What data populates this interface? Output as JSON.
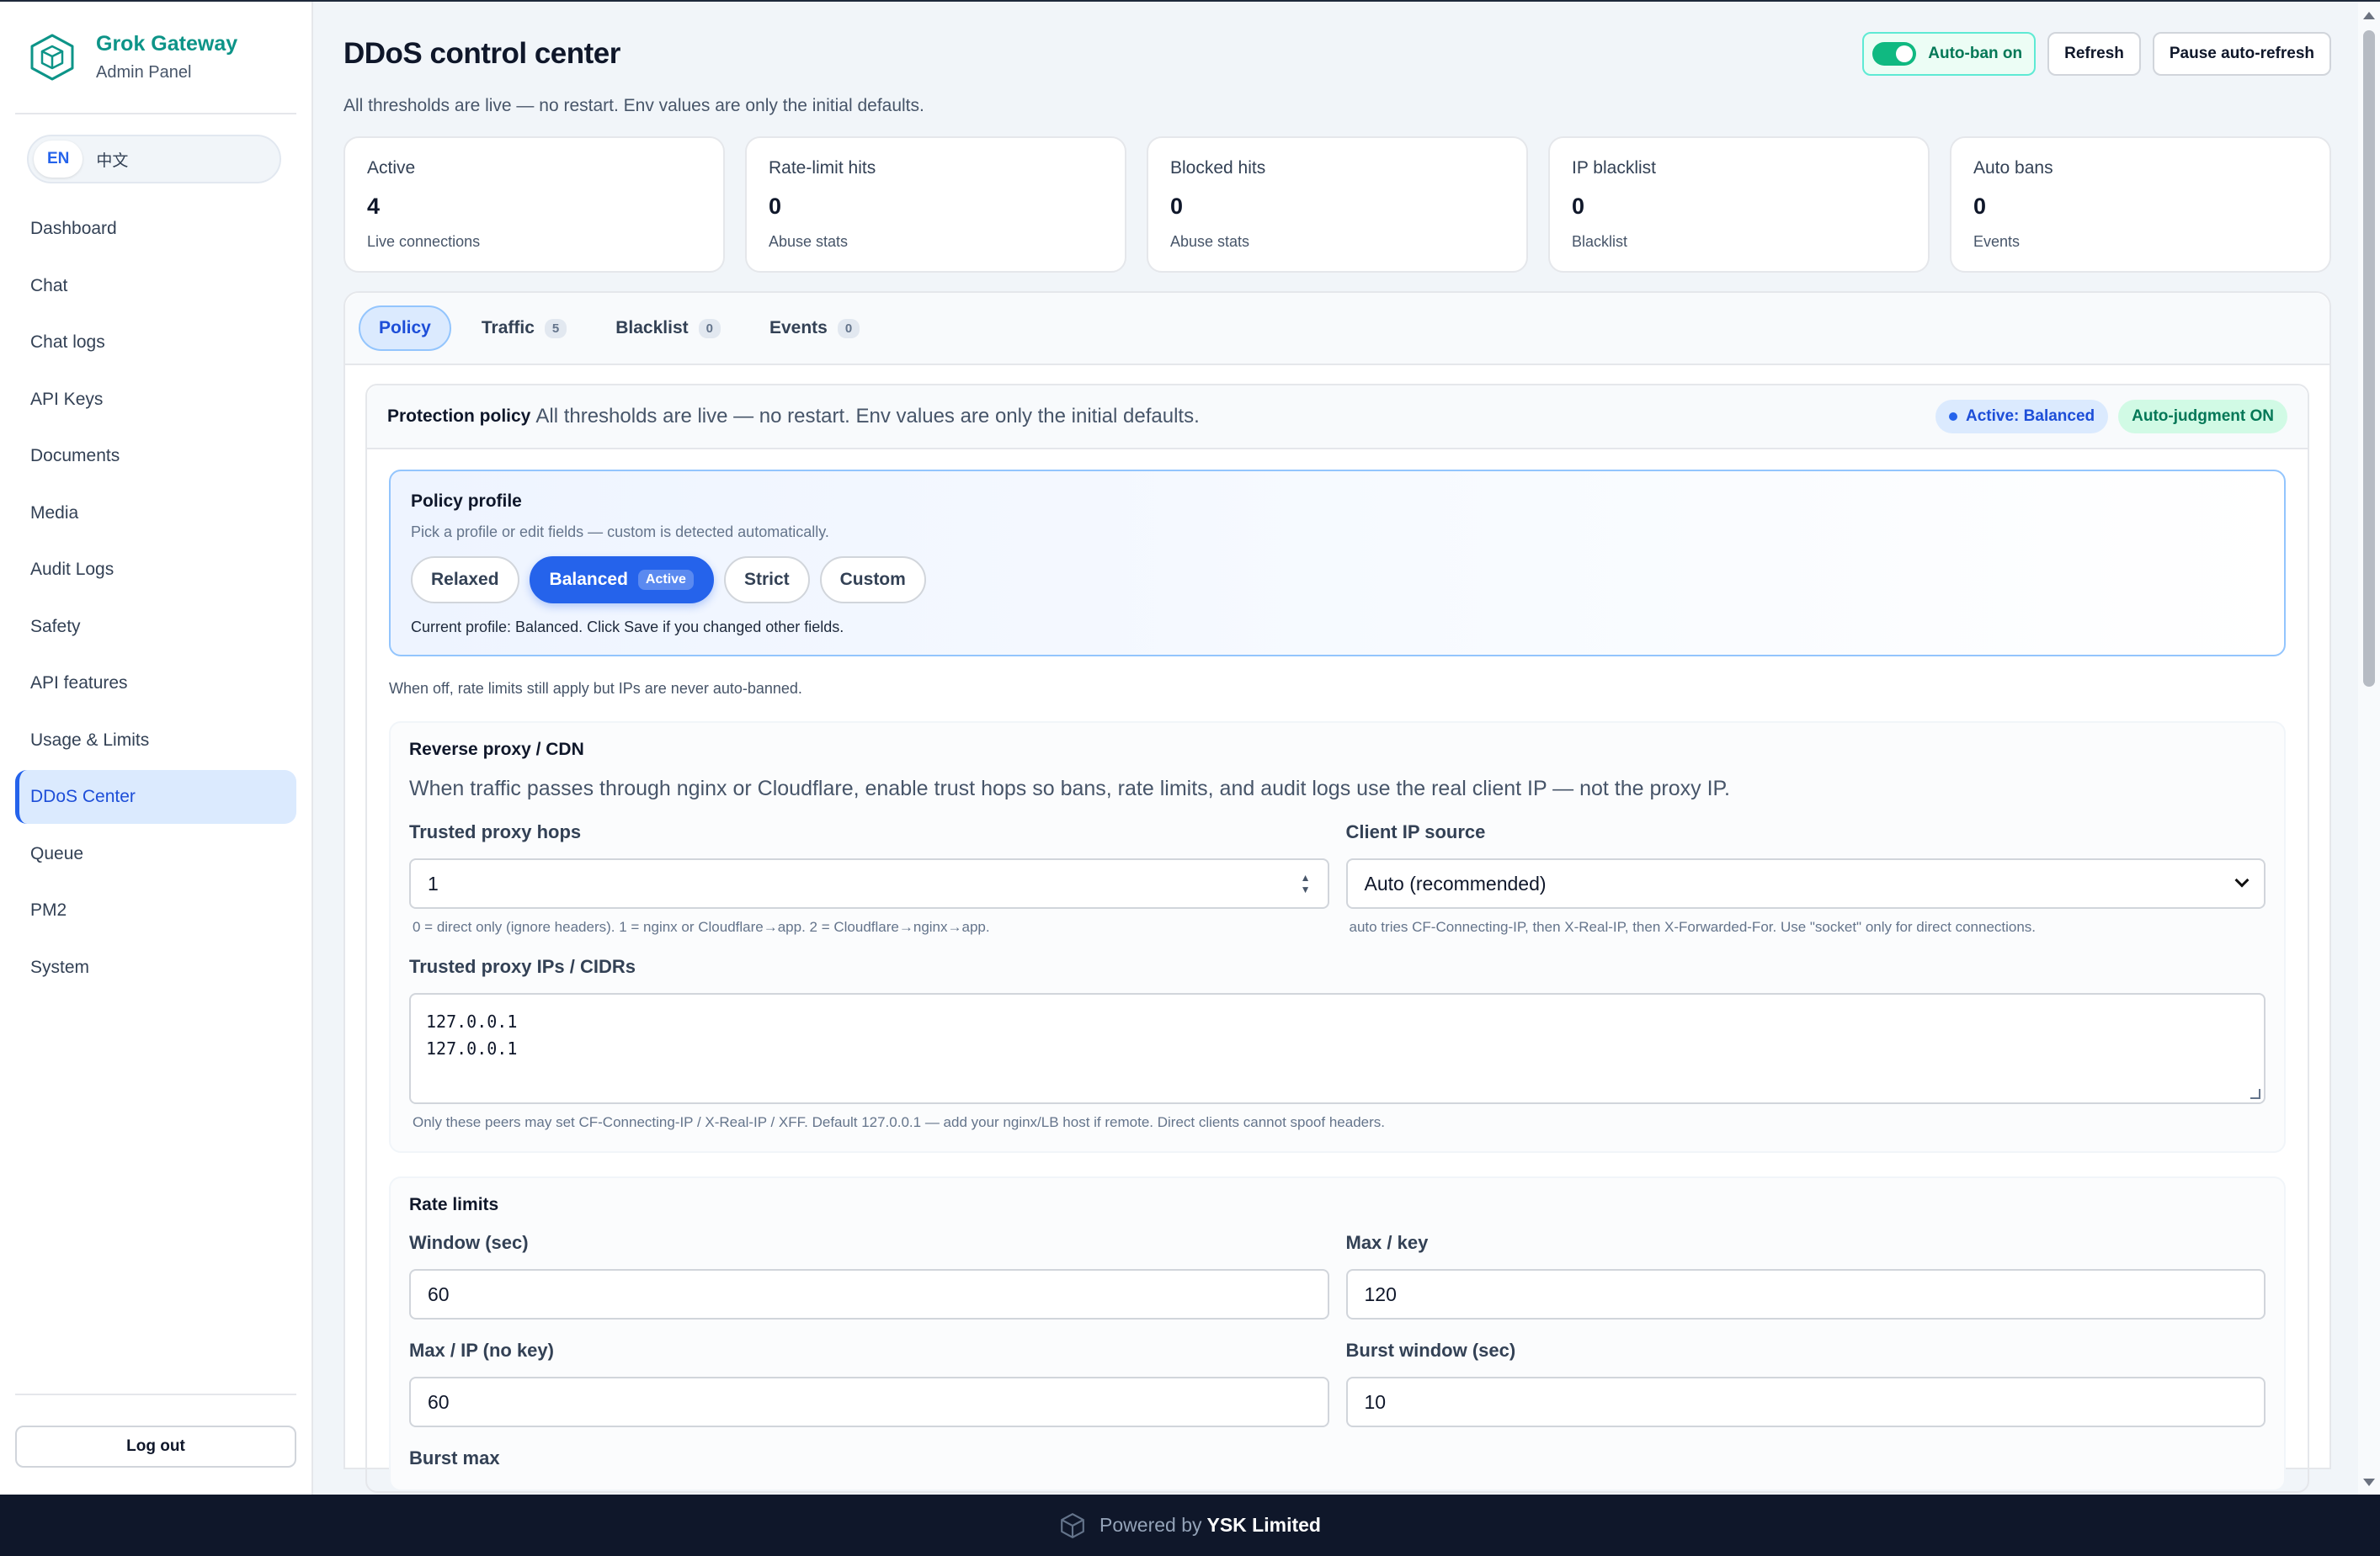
{
  "brand": {
    "name": "Grok Gateway",
    "subtitle": "Admin Panel"
  },
  "lang": {
    "en": "EN",
    "zh": "中文"
  },
  "nav": [
    "Dashboard",
    "Chat",
    "Chat logs",
    "API Keys",
    "Documents",
    "Media",
    "Audit Logs",
    "Safety",
    "API features",
    "Usage & Limits",
    "DDoS Center",
    "Queue",
    "PM2",
    "System"
  ],
  "nav_active": "DDoS Center",
  "logout": "Log out",
  "header": {
    "title": "DDoS control center",
    "subtitle": "All thresholds are live — no restart. Env values are only the initial defaults.",
    "autoban": "Auto-ban on",
    "refresh": "Refresh",
    "pause": "Pause auto-refresh"
  },
  "stats": [
    {
      "label": "Active",
      "value": "4",
      "note": "Live connections"
    },
    {
      "label": "Rate-limit hits",
      "value": "0",
      "note": "Abuse stats"
    },
    {
      "label": "Blocked hits",
      "value": "0",
      "note": "Abuse stats"
    },
    {
      "label": "IP blacklist",
      "value": "0",
      "note": "Blacklist"
    },
    {
      "label": "Auto bans",
      "value": "0",
      "note": "Events"
    }
  ],
  "tabs": [
    {
      "label": "Policy",
      "count": ""
    },
    {
      "label": "Traffic",
      "count": "5"
    },
    {
      "label": "Blacklist",
      "count": "0"
    },
    {
      "label": "Events",
      "count": "0"
    }
  ],
  "policy": {
    "title": "Protection policy",
    "subtitle": "All thresholds are live — no restart. Env values are only the initial defaults.",
    "badge_active": "Active: Balanced",
    "badge_auto": "Auto-judgment ON",
    "profile_title": "Policy profile",
    "profile_sub": "Pick a profile or edit fields — custom is detected automatically.",
    "profiles": [
      "Relaxed",
      "Balanced",
      "Strict",
      "Custom"
    ],
    "active_tag": "Active",
    "current": "Current profile: Balanced. Click Save if you changed other fields.",
    "note": "When off, rate limits still apply but IPs are never auto-banned."
  },
  "proxy": {
    "title": "Reverse proxy / CDN",
    "desc": "When traffic passes through nginx or Cloudflare, enable trust hops so bans, rate limits, and audit logs use the real client IP — not the proxy IP.",
    "hops_label": "Trusted proxy hops",
    "hops_value": "1",
    "hops_help": "0 = direct only (ignore headers). 1 = nginx or Cloudflare→app. 2 = Cloudflare→nginx→app.",
    "source_label": "Client IP source",
    "source_value": "Auto (recommended)",
    "source_help": "auto tries CF-Connecting-IP, then X-Real-IP, then X-Forwarded-For. Use \"socket\" only for direct connections.",
    "cidrs_label": "Trusted proxy IPs / CIDRs",
    "cidrs_line1": "127.0.0.1",
    "cidrs_line2": "127.0.0.1",
    "cidrs_help": "Only these peers may set CF-Connecting-IP / X-Real-IP / XFF. Default 127.0.0.1 — add your nginx/LB host if remote. Direct clients cannot spoof headers."
  },
  "rate": {
    "title": "Rate limits",
    "window_label": "Window (sec)",
    "window_value": "60",
    "maxkey_label": "Max / key",
    "maxkey_value": "120",
    "maxip_label": "Max / IP (no key)",
    "maxip_value": "60",
    "burstwin_label": "Burst window (sec)",
    "burstwin_value": "10",
    "burstmax_label": "Burst max"
  },
  "footer": {
    "prefix": "Powered by",
    "company": "YSK Limited"
  },
  "colors": {
    "accent": "#2563eb",
    "brand": "#0d9488",
    "success": "#10b981",
    "footer": "#0f172a"
  }
}
